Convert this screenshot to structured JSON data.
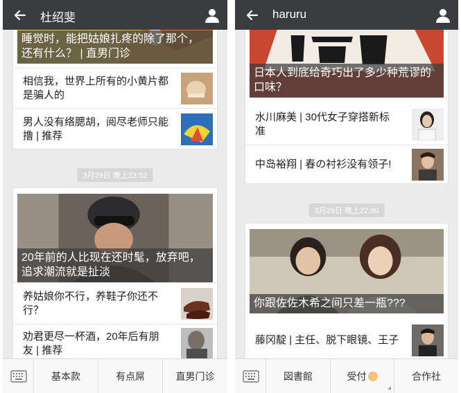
{
  "left": {
    "title": "杜绍斐",
    "card1": {
      "hero_caption": "睡觉时，能把姑娘扎疼的除了那个，还有什么？ | 直男门诊",
      "items": [
        {
          "text": "相信我，世界上所有的小黄片都是骗人的"
        },
        {
          "text": "男人没有络腮胡，阅尽老师只能撸 | 推荐"
        }
      ]
    },
    "timestamp": "3月29日 晚上23:52",
    "card2": {
      "hero_caption": "20年前的人比现在还时髦，放弃吧，追求潮流就是扯淡",
      "items": [
        {
          "text": "养姑娘你不行，养鞋子你还不行？"
        },
        {
          "text": "劝君更尽一杯酒，20年后有朋友 | 推荐"
        }
      ]
    },
    "menu": [
      "基本款",
      "有点屌",
      "直男门诊"
    ]
  },
  "right": {
    "title": "haruru",
    "card1": {
      "hero_caption": "日本人到底给奇巧出了多少种荒谬的口味？",
      "items": [
        {
          "text": "水川麻美 | 30代女子穿搭新标准"
        },
        {
          "text": "中岛裕翔 | 春の衬衫没有领子!"
        }
      ]
    },
    "timestamp": "3月29日 晚上22:00",
    "card2": {
      "hero_caption": "你跟佐佐木希之间只差一瓶???",
      "items": [
        {
          "text": "藤冈靛 | 主任、脱下眼镜、王子"
        }
      ]
    },
    "menu": [
      "図書館",
      "受付",
      "合作社"
    ]
  },
  "colors": {
    "titlebar": "#3a3c3f",
    "background": "#ebebeb",
    "caption_overlay": "#3c3c3c"
  }
}
